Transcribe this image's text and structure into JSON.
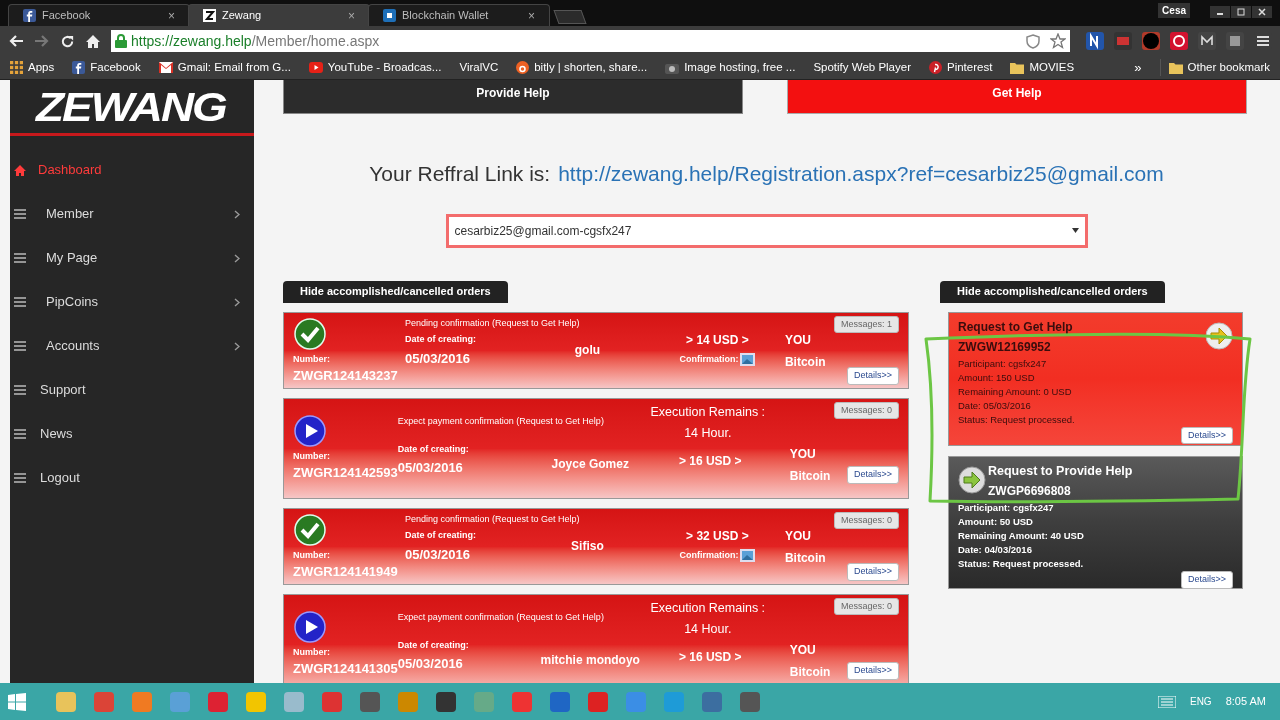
{
  "browser": {
    "tabs": [
      {
        "label": "Facebook",
        "selected": false,
        "close": "×"
      },
      {
        "label": "Zewang",
        "selected": true,
        "close": "×"
      },
      {
        "label": "Blockchain Wallet",
        "selected": false,
        "close": "×"
      }
    ],
    "profile": "Cesa",
    "url_host": "https://zewang.help",
    "url_path": "/Member/home.aspx",
    "bookmarks": [
      "Apps",
      "Facebook",
      "Gmail: Email from G...",
      "YouTube - Broadcas...",
      "ViralVC",
      "bitly | shorten, share...",
      "Image hosting, free ...",
      "Spotify Web Player",
      "Pinterest",
      "MOVIES"
    ],
    "overflow": "»",
    "other_bookmarks": "Other bookmark"
  },
  "sidebar": {
    "logo": "ZEWANG",
    "items": [
      {
        "label": "Dashboard",
        "selected": true,
        "submenu": false
      },
      {
        "label": "Member",
        "selected": false,
        "submenu": true
      },
      {
        "label": "My Page",
        "selected": false,
        "submenu": true
      },
      {
        "label": "PipCoins",
        "selected": false,
        "submenu": true
      },
      {
        "label": "Accounts",
        "selected": false,
        "submenu": true
      },
      {
        "label": "Support",
        "selected": false,
        "submenu": false
      },
      {
        "label": "News",
        "selected": false,
        "submenu": false
      },
      {
        "label": "Logout",
        "selected": false,
        "submenu": false
      }
    ]
  },
  "top_buttons": [
    {
      "label": "Provide Help",
      "kind": "provide"
    },
    {
      "label": "Get Help",
      "kind": "get"
    }
  ],
  "referral": {
    "label": "Your Reffral Link is:",
    "link": "http://zewang.help/Registration.aspx?ref=cesarbiz25@gmail.com"
  },
  "account_select": {
    "value": "cesarbiz25@gmail.com-cgsfx247"
  },
  "orders": {
    "hide_button": "Hide accomplished/cancelled orders",
    "items": [
      {
        "kind": "confirmed",
        "status": "Pending confirmation (Request to Get Help)",
        "number_label": "Number:",
        "number": "ZWGR124143237",
        "date_label": "Date of creating:",
        "date": "05/03/2016",
        "participant": "golu",
        "amount": "> 14 USD >",
        "confirmation": "Confirmation:",
        "recipient": "YOU",
        "method": "Bitcoin",
        "messages": "Messages: 1",
        "details": "Details>>"
      },
      {
        "kind": "pending",
        "status": "Expect payment confirmation (Request to Get Help)",
        "execution_label": "Execution Remains :",
        "execution_value": "14 Hour.",
        "number_label": "Number:",
        "number": "ZWGR124142593",
        "date_label": "Date of creating:",
        "date": "05/03/2016",
        "participant": "Joyce Gomez",
        "amount": "> 16 USD >",
        "recipient": "YOU",
        "method": "Bitcoin",
        "messages": "Messages: 0",
        "details": "Details>>"
      },
      {
        "kind": "confirmed",
        "status": "Pending confirmation (Request to Get Help)",
        "number_label": "Number:",
        "number": "ZWGR124141949",
        "date_label": "Date of creating:",
        "date": "05/03/2016",
        "participant": "Sifiso",
        "amount": "> 32 USD >",
        "confirmation": "Confirmation:",
        "recipient": "YOU",
        "method": "Bitcoin",
        "messages": "Messages: 0",
        "details": "Details>>"
      },
      {
        "kind": "pending",
        "status": "Expect payment confirmation (Request to Get Help)",
        "execution_label": "Execution Remains :",
        "execution_value": "14 Hour.",
        "number_label": "Number:",
        "number": "ZWGR124141305",
        "date_label": "Date of creating:",
        "date": "05/03/2016",
        "participant": "mitchie mondoyo",
        "amount": "> 16 USD >",
        "recipient": "YOU",
        "method": "Bitcoin",
        "messages": "Messages: 0",
        "details": "Details>>"
      }
    ]
  },
  "requests": {
    "hide_button": "Hide accomplished/cancelled orders",
    "items": [
      {
        "kind": "get",
        "title": "Request to Get Help",
        "id": "ZWGW12169952",
        "lines": [
          "Participant: cgsfx247",
          "Amount: 150 USD",
          "Remaining Amount: 0 USD",
          "Date: 05/03/2016",
          "Status: Request processed."
        ],
        "details": "Details>>"
      },
      {
        "kind": "provide",
        "title": "Request to Provide Help",
        "id": "ZWGP6696808",
        "lines": [
          "Participant: cgsfx247",
          "Amount: 50 USD",
          "Remaining Amount: 40 USD",
          "Date: 04/03/2016",
          "Status: Request processed."
        ],
        "details": "Details>>"
      }
    ]
  },
  "taskbar": {
    "language": "ENG",
    "time": "8:05 AM"
  }
}
